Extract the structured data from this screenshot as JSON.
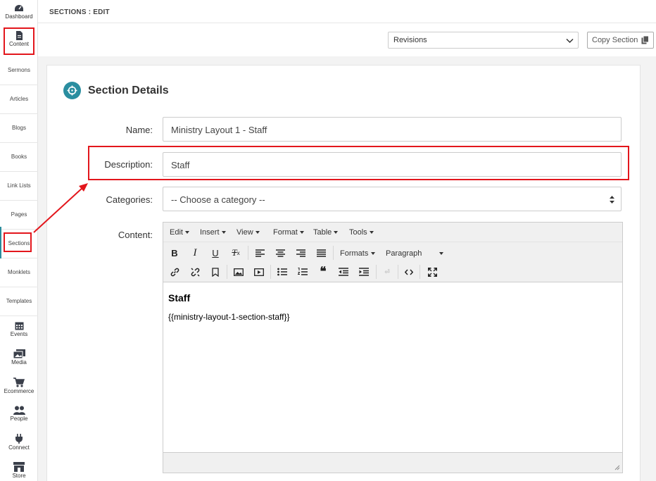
{
  "sidebar": {
    "items": [
      {
        "label": "Dashboard",
        "icon": "dashboard-icon"
      },
      {
        "label": "Content",
        "icon": "document-icon"
      },
      {
        "label": "Sermons"
      },
      {
        "label": "Articles"
      },
      {
        "label": "Blogs"
      },
      {
        "label": "Books"
      },
      {
        "label": "Link Lists"
      },
      {
        "label": "Pages"
      },
      {
        "label": "Sections"
      },
      {
        "label": "Monklets"
      },
      {
        "label": "Templates"
      },
      {
        "label": "Events",
        "icon": "calendar-icon"
      },
      {
        "label": "Media",
        "icon": "images-icon"
      },
      {
        "label": "Ecommerce",
        "icon": "cart-icon"
      },
      {
        "label": "People",
        "icon": "people-icon"
      },
      {
        "label": "Connect",
        "icon": "plug-icon"
      },
      {
        "label": "Store",
        "icon": "store-icon"
      }
    ]
  },
  "header": {
    "breadcrumb": "SECTIONS : EDIT"
  },
  "toolbar": {
    "revisions_value": "Revisions",
    "copy_label": "Copy Section"
  },
  "card": {
    "title": "Section Details",
    "fields": {
      "name_label": "Name:",
      "name_value": "Ministry Layout 1 - Staff",
      "description_label": "Description:",
      "description_value": "Staff",
      "categories_label": "Categories:",
      "categories_value": "-- Choose a category --",
      "content_label": "Content:"
    }
  },
  "editor": {
    "menus": [
      "Edit",
      "Insert",
      "View",
      "Format",
      "Table",
      "Tools"
    ],
    "formats_label": "Formats",
    "block_label": "Paragraph",
    "content_heading": "Staff",
    "content_paragraph": "{{ministry-layout-1-section-staff}}"
  },
  "colors": {
    "accent": "#2a8ea0",
    "highlight": "#e3161c"
  }
}
